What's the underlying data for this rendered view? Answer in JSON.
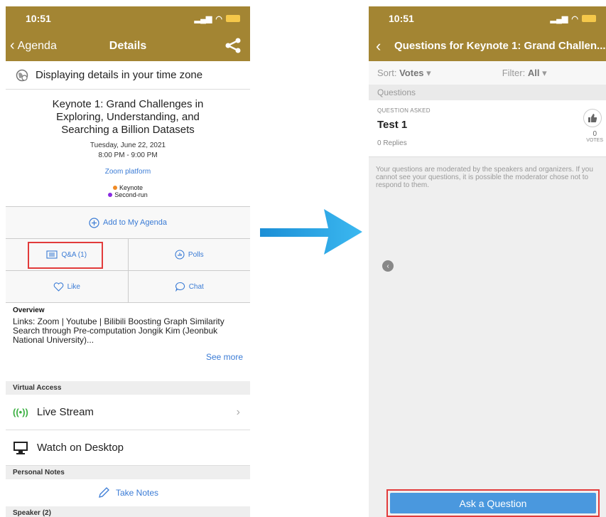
{
  "left": {
    "status": {
      "time": "10:51"
    },
    "nav": {
      "back_label": "Agenda",
      "title": "Details"
    },
    "timezone_text": "Displaying details in your time zone",
    "event": {
      "title": "Keynote 1: Grand Challenges in Exploring, Understanding, and Searching a Billion Datasets",
      "date": "Tuesday, June 22, 2021",
      "time": "8:00 PM - 9:00 PM",
      "venue": "Zoom platform",
      "tags": [
        {
          "label": "Keynote",
          "color": "#f08a24"
        },
        {
          "label": "Second-run",
          "color": "#8a2be2"
        }
      ]
    },
    "actions": {
      "add_agenda": "Add to My Agenda",
      "qa": "Q&A (1)",
      "polls": "Polls",
      "like": "Like",
      "chat": "Chat"
    },
    "overview": {
      "heading": "Overview",
      "body": "Links: Zoom | Youtube | Bilibili Boosting Graph Similarity Search through Pre-computation Jongik Kim (Jeonbuk National University)...",
      "see_more": "See more"
    },
    "virtual_access": {
      "heading": "Virtual Access",
      "live_stream": "Live Stream",
      "watch_desktop": "Watch on Desktop"
    },
    "personal_notes": {
      "heading": "Personal Notes",
      "take_notes": "Take Notes"
    },
    "speaker_heading": "Speaker (2)"
  },
  "right": {
    "status": {
      "time": "10:51"
    },
    "nav": {
      "title": "Questions for Keynote 1: Grand Challen..."
    },
    "sort": {
      "label": "Sort:",
      "value": "Votes"
    },
    "filter": {
      "label": "Filter:",
      "value": "All"
    },
    "questions_heading": "Questions",
    "question": {
      "label": "QUESTION ASKED",
      "text": "Test 1",
      "replies": "0 Replies",
      "votes": "0",
      "votes_label": "VOTES"
    },
    "moderation_note": "Your questions are moderated by the speakers and organizers.  If you cannot see your questions, it is possible the moderator chose not to respond to them.",
    "ask_button": "Ask a Question"
  },
  "colors": {
    "header": "#a38533",
    "accent": "#3a7bd5",
    "highlight": "#e23b3b",
    "ask_button": "#4a98de",
    "arrow": "#2aa6e6"
  }
}
